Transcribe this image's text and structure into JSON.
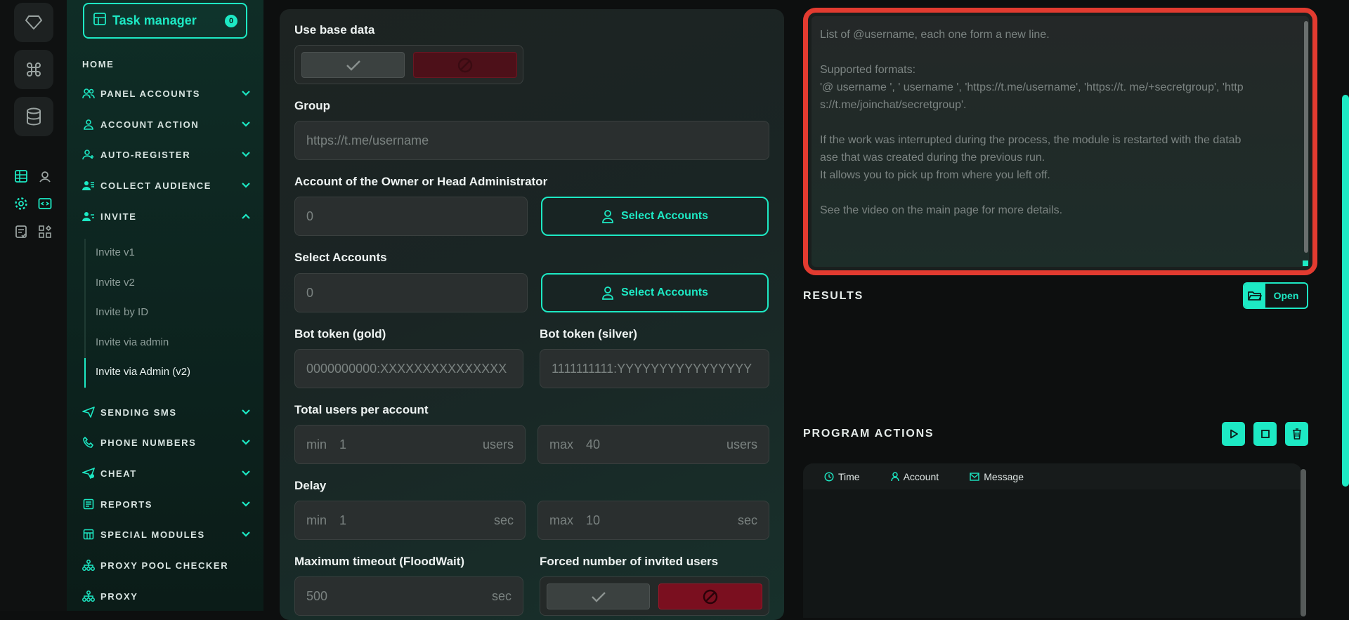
{
  "rail": {
    "icons": [
      "diamond-icon",
      "command-icon",
      "database-icon"
    ],
    "small_icons": [
      "list-icon",
      "location-icon",
      "settings-icon",
      "code-icon",
      "checklist-icon",
      "widgets-icon"
    ]
  },
  "sidebar": {
    "task_manager": {
      "label": "Task manager",
      "count": "0"
    },
    "home": "HOME",
    "items": [
      {
        "label": "PANEL ACCOUNTS",
        "icon": "users-icon"
      },
      {
        "label": "ACCOUNT ACTION",
        "icon": "user-icon"
      },
      {
        "label": "AUTO-REGISTER",
        "icon": "user-plus-icon"
      },
      {
        "label": "COLLECT AUDIENCE",
        "icon": "user-list-icon"
      },
      {
        "label": "INVITE",
        "icon": "user-invite-icon"
      },
      {
        "label": "SENDING SMS",
        "icon": "send-icon"
      },
      {
        "label": "PHONE NUMBERS",
        "icon": "phone-icon"
      },
      {
        "label": "CHEAT",
        "icon": "cheat-icon"
      },
      {
        "label": "REPORTS",
        "icon": "report-icon"
      },
      {
        "label": "SPECIAL MODULES",
        "icon": "modules-icon"
      },
      {
        "label": "PROXY POOL CHECKER",
        "icon": "network-icon"
      },
      {
        "label": "PROXY",
        "icon": "network-icon"
      }
    ],
    "invite_sub": [
      "Invite v1",
      "Invite v2",
      "Invite by ID",
      "Invite via admin",
      "Invite via Admin (v2)"
    ]
  },
  "form": {
    "use_base_data": {
      "label": "Use base data"
    },
    "group": {
      "label": "Group",
      "placeholder": "https://t.me/username"
    },
    "owner": {
      "label": "Account of the Owner or Head Administrator",
      "value": "0",
      "button": "Select Accounts"
    },
    "select_accounts": {
      "label": "Select Accounts",
      "value": "0",
      "button": "Select Accounts"
    },
    "bot_gold": {
      "label": "Bot token (gold)",
      "placeholder": "0000000000:XXXXXXXXXXXXXXX"
    },
    "bot_silver": {
      "label": "Bot token (silver)",
      "placeholder": "1111111111:YYYYYYYYYYYYYYYY"
    },
    "total_users": {
      "label": "Total users per account",
      "min_prefix": "min",
      "min_value": "1",
      "max_prefix": "max",
      "max_value": "40",
      "unit": "users"
    },
    "delay": {
      "label": "Delay",
      "min_prefix": "min",
      "min_value": "1",
      "max_prefix": "max",
      "max_value": "10",
      "unit": "sec"
    },
    "max_timeout": {
      "label": "Maximum timeout (FloodWait)",
      "value": "500",
      "unit": "sec"
    },
    "forced": {
      "label": "Forced number of invited users"
    }
  },
  "usernames_help": {
    "lines": [
      "List of @username, each one form a new line.",
      "",
      "Supported formats:",
      "'@ username ', ' username ', 'https://t.me/username', 'https://t. me/+secretgroup', 'http",
      "s://t.me/joinchat/secretgroup'.",
      "",
      "If the work was interrupted during the process, the module is restarted with the datab",
      "ase that was created during the previous run.",
      "It allows you to pick up from where you left off.",
      "",
      "See the video on the main page for more details."
    ]
  },
  "results": {
    "title": "RESULTS",
    "open": "Open"
  },
  "program_actions": {
    "title": "PROGRAM ACTIONS",
    "columns": [
      "Time",
      "Account",
      "Message"
    ]
  }
}
